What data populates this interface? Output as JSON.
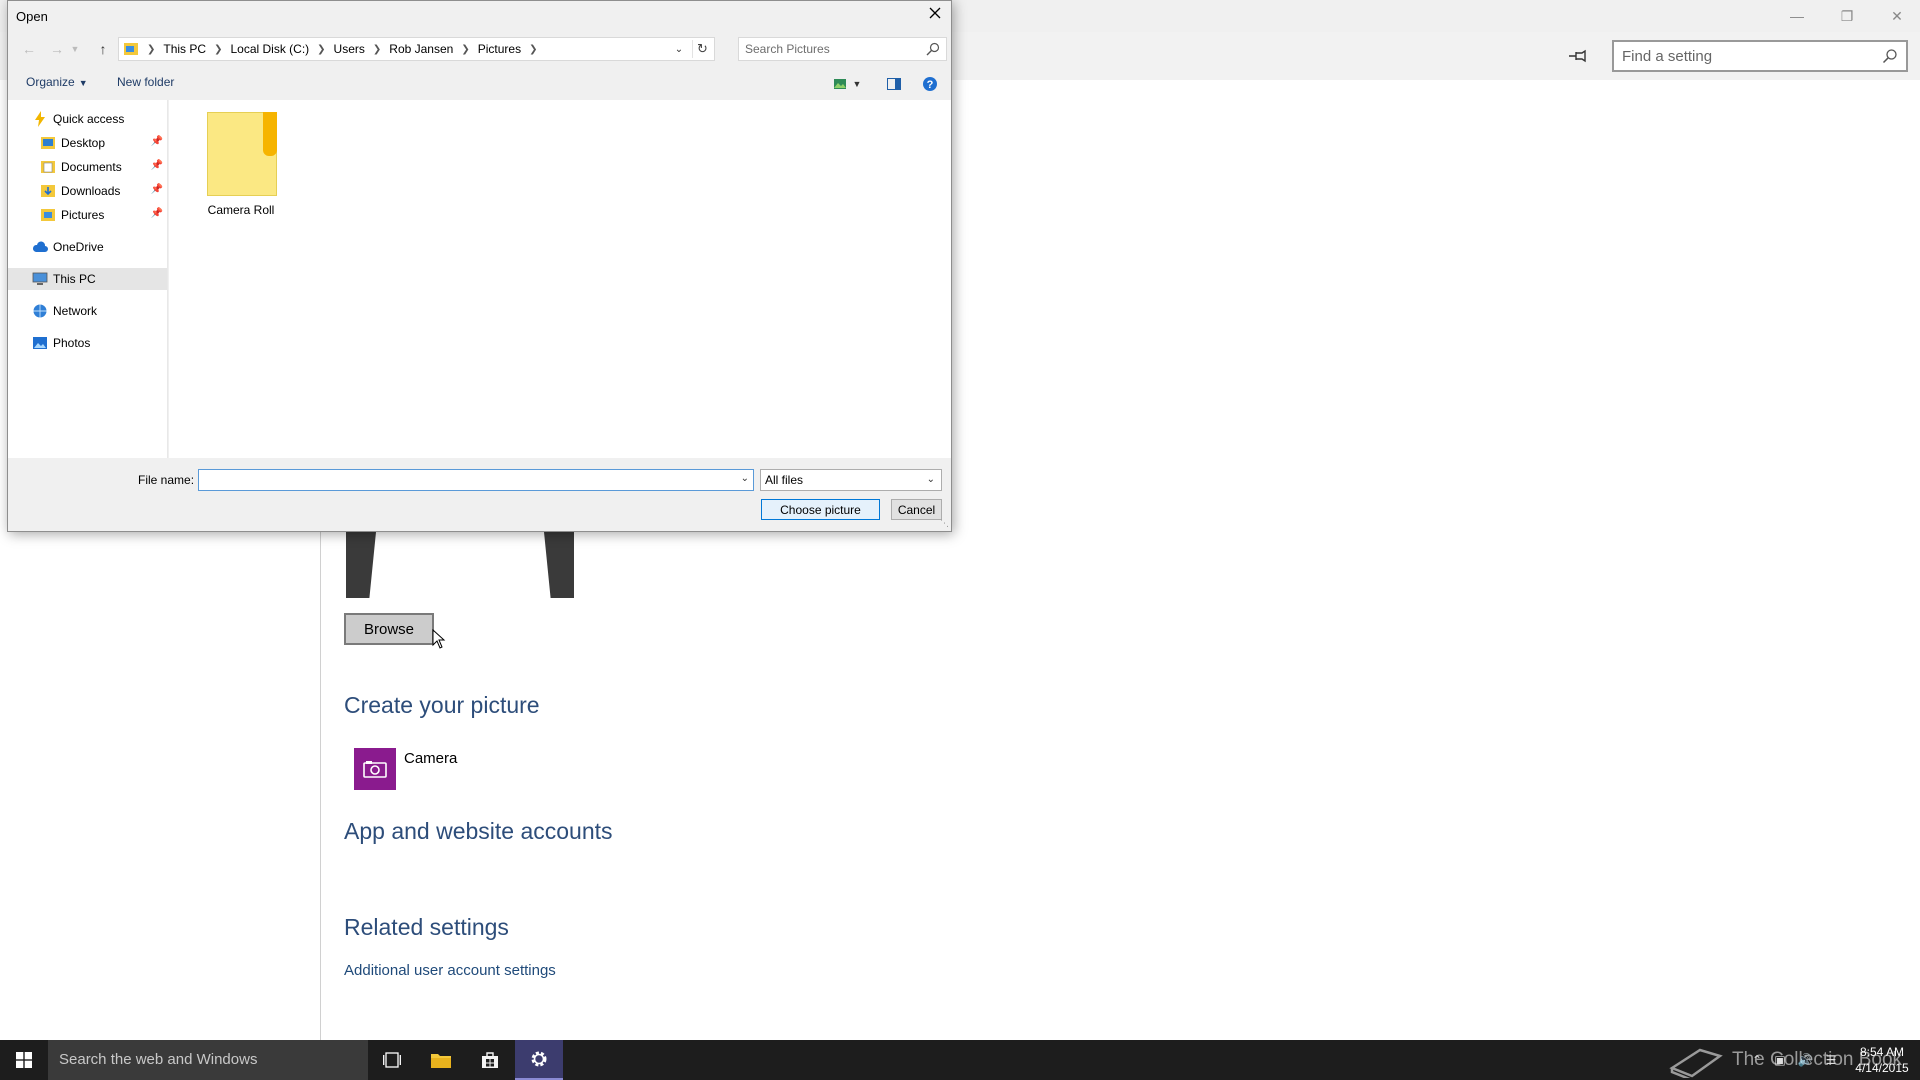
{
  "dialog": {
    "title": "Open",
    "breadcrumbs": [
      "This PC",
      "Local Disk (C:)",
      "Users",
      "Rob Jansen",
      "Pictures"
    ],
    "search_placeholder": "Search Pictures",
    "toolbar": {
      "organize_label": "Organize",
      "new_folder_label": "New folder"
    },
    "nav": {
      "quick_access": "Quick access",
      "quick_items": [
        {
          "label": "Desktop",
          "icon": "desktop-icon",
          "pinned": true
        },
        {
          "label": "Documents",
          "icon": "documents-icon",
          "pinned": true
        },
        {
          "label": "Downloads",
          "icon": "downloads-icon",
          "pinned": true
        },
        {
          "label": "Pictures",
          "icon": "pictures-icon",
          "pinned": true
        }
      ],
      "onedrive": "OneDrive",
      "this_pc": "This PC",
      "network": "Network",
      "photos": "Photos",
      "selected": "This PC"
    },
    "files": [
      {
        "name": "Camera Roll",
        "type": "folder"
      }
    ],
    "file_name_label": "File name:",
    "file_name_value": "",
    "file_type": "All files",
    "choose_label": "Choose picture",
    "cancel_label": "Cancel"
  },
  "settings": {
    "search_placeholder": "Find a setting",
    "browse_label": "Browse",
    "create_heading": "Create your picture",
    "camera_label": "Camera",
    "accounts_heading": "App and website accounts",
    "related_heading": "Related settings",
    "related_link": "Additional user account settings"
  },
  "taskbar": {
    "search_placeholder": "Search the web and Windows",
    "watermark": "The Collection Book",
    "time": "8:54 AM",
    "date": "4/14/2015"
  },
  "colors": {
    "accent": "#0078d7",
    "heading": "#2d4d7a",
    "camera_tile": "#8a1b8e",
    "folder": "#fbe883",
    "taskbar": "#1d1d1d"
  }
}
